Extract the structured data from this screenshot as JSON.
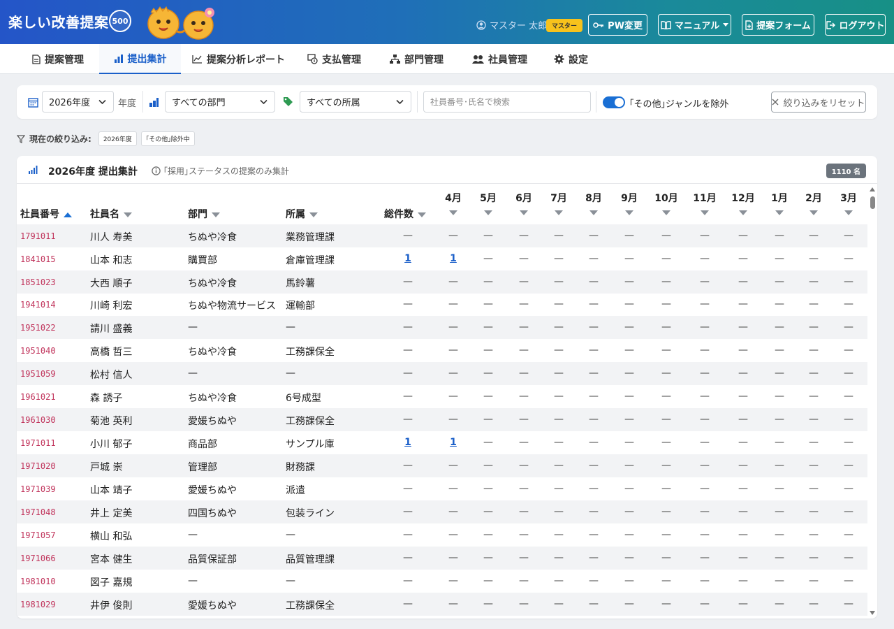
{
  "header": {
    "brand": "楽しい改善提案",
    "badge": "500",
    "user_name": "マスター 太郎",
    "user_role": "マスター",
    "buttons": {
      "pw_change": "PW変更",
      "manual": "マニュアル",
      "proposal_form": "提案フォーム",
      "logout": "ログアウト"
    }
  },
  "nav": {
    "tabs": [
      {
        "label": "提案管理",
        "icon": "document-icon"
      },
      {
        "label": "提出集計",
        "icon": "bar-chart-icon",
        "active": true
      },
      {
        "label": "提案分析レポート",
        "icon": "line-chart-icon"
      },
      {
        "label": "支払管理",
        "icon": "payment-icon"
      },
      {
        "label": "部門管理",
        "icon": "org-chart-icon"
      },
      {
        "label": "社員管理",
        "icon": "users-icon"
      },
      {
        "label": "設定",
        "icon": "gear-icon"
      }
    ]
  },
  "filters": {
    "year_value": "2026年度",
    "year_suffix": "年度",
    "department_value": "すべての部門",
    "section_value": "すべての所属",
    "search_placeholder": "社員番号･氏名で検索",
    "exclude_other_label": "｢その他｣ジャンルを除外",
    "exclude_other_on": true,
    "reset_label": "絞り込みをリセット"
  },
  "current_filters": {
    "label": "現在の絞り込み:",
    "chips": [
      "2026年度",
      "｢その他｣除外中"
    ]
  },
  "colors": {
    "accent": "#1a5fc9",
    "id_text": "#c0325a",
    "role_badge": "#f7c21c"
  },
  "summary": {
    "title": "2026年度 提出集計",
    "note": "｢採用｣ステータスの提案のみ集計",
    "count": "1110 名",
    "columns": {
      "emp_id": "社員番号",
      "name": "社員名",
      "department": "部門",
      "section": "所属",
      "total": "総件数",
      "months": [
        "4月",
        "5月",
        "6月",
        "7月",
        "8月",
        "9月",
        "10月",
        "11月",
        "12月",
        "1月",
        "2月",
        "3月"
      ]
    },
    "rows": [
      {
        "id": "1791011",
        "name": "川人 寿美",
        "dept": "ちぬや冷食",
        "sec": "業務管理課",
        "total": "—",
        "months": [
          "—",
          "—",
          "—",
          "—",
          "—",
          "—",
          "—",
          "—",
          "—",
          "—",
          "—",
          "—"
        ]
      },
      {
        "id": "1841015",
        "name": "山本 和志",
        "dept": "購買部",
        "sec": "倉庫管理課",
        "total": "1",
        "months": [
          "1",
          "—",
          "—",
          "—",
          "—",
          "—",
          "—",
          "—",
          "—",
          "—",
          "—",
          "—"
        ]
      },
      {
        "id": "1851023",
        "name": "大西 順子",
        "dept": "ちぬや冷食",
        "sec": "馬鈴薯",
        "total": "—",
        "months": [
          "—",
          "—",
          "—",
          "—",
          "—",
          "—",
          "—",
          "—",
          "—",
          "—",
          "—",
          "—"
        ]
      },
      {
        "id": "1941014",
        "name": "川崎 利宏",
        "dept": "ちぬや物流サービス",
        "sec": "運輸部",
        "total": "—",
        "months": [
          "—",
          "—",
          "—",
          "—",
          "—",
          "—",
          "—",
          "—",
          "—",
          "—",
          "—",
          "—"
        ]
      },
      {
        "id": "1951022",
        "name": "請川 盛義",
        "dept": "—",
        "sec": "—",
        "total": "—",
        "months": [
          "—",
          "—",
          "—",
          "—",
          "—",
          "—",
          "—",
          "—",
          "—",
          "—",
          "—",
          "—"
        ]
      },
      {
        "id": "1951040",
        "name": "高橋 哲三",
        "dept": "ちぬや冷食",
        "sec": "工務課保全",
        "total": "—",
        "months": [
          "—",
          "—",
          "—",
          "—",
          "—",
          "—",
          "—",
          "—",
          "—",
          "—",
          "—",
          "—"
        ]
      },
      {
        "id": "1951059",
        "name": "松村 信人",
        "dept": "—",
        "sec": "—",
        "total": "—",
        "months": [
          "—",
          "—",
          "—",
          "—",
          "—",
          "—",
          "—",
          "—",
          "—",
          "—",
          "—",
          "—"
        ]
      },
      {
        "id": "1961021",
        "name": "森 誘子",
        "dept": "ちぬや冷食",
        "sec": "6号成型",
        "total": "—",
        "months": [
          "—",
          "—",
          "—",
          "—",
          "—",
          "—",
          "—",
          "—",
          "—",
          "—",
          "—",
          "—"
        ]
      },
      {
        "id": "1961030",
        "name": "菊池 英利",
        "dept": "愛媛ちぬや",
        "sec": "工務課保全",
        "total": "—",
        "months": [
          "—",
          "—",
          "—",
          "—",
          "—",
          "—",
          "—",
          "—",
          "—",
          "—",
          "—",
          "—"
        ]
      },
      {
        "id": "1971011",
        "name": "小川 郁子",
        "dept": "商品部",
        "sec": "サンプル庫",
        "total": "1",
        "months": [
          "1",
          "—",
          "—",
          "—",
          "—",
          "—",
          "—",
          "—",
          "—",
          "—",
          "—",
          "—"
        ]
      },
      {
        "id": "1971020",
        "name": "戸城 崇",
        "dept": "管理部",
        "sec": "財務課",
        "total": "—",
        "months": [
          "—",
          "—",
          "—",
          "—",
          "—",
          "—",
          "—",
          "—",
          "—",
          "—",
          "—",
          "—"
        ]
      },
      {
        "id": "1971039",
        "name": "山本 靖子",
        "dept": "愛媛ちぬや",
        "sec": "派遣",
        "total": "—",
        "months": [
          "—",
          "—",
          "—",
          "—",
          "—",
          "—",
          "—",
          "—",
          "—",
          "—",
          "—",
          "—"
        ]
      },
      {
        "id": "1971048",
        "name": "井上 定美",
        "dept": "四国ちぬや",
        "sec": "包装ライン",
        "total": "—",
        "months": [
          "—",
          "—",
          "—",
          "—",
          "—",
          "—",
          "—",
          "—",
          "—",
          "—",
          "—",
          "—"
        ]
      },
      {
        "id": "1971057",
        "name": "横山 和弘",
        "dept": "—",
        "sec": "—",
        "total": "—",
        "months": [
          "—",
          "—",
          "—",
          "—",
          "—",
          "—",
          "—",
          "—",
          "—",
          "—",
          "—",
          "—"
        ]
      },
      {
        "id": "1971066",
        "name": "宮本 健生",
        "dept": "品質保証部",
        "sec": "品質管理課",
        "total": "—",
        "months": [
          "—",
          "—",
          "—",
          "—",
          "—",
          "—",
          "—",
          "—",
          "—",
          "—",
          "—",
          "—"
        ]
      },
      {
        "id": "1981010",
        "name": "図子 嘉規",
        "dept": "—",
        "sec": "—",
        "total": "—",
        "months": [
          "—",
          "—",
          "—",
          "—",
          "—",
          "—",
          "—",
          "—",
          "—",
          "—",
          "—",
          "—"
        ]
      },
      {
        "id": "1981029",
        "name": "井伊 俊則",
        "dept": "愛媛ちぬや",
        "sec": "工務課保全",
        "total": "—",
        "months": [
          "—",
          "—",
          "—",
          "—",
          "—",
          "—",
          "—",
          "—",
          "—",
          "—",
          "—",
          "—"
        ]
      }
    ]
  }
}
